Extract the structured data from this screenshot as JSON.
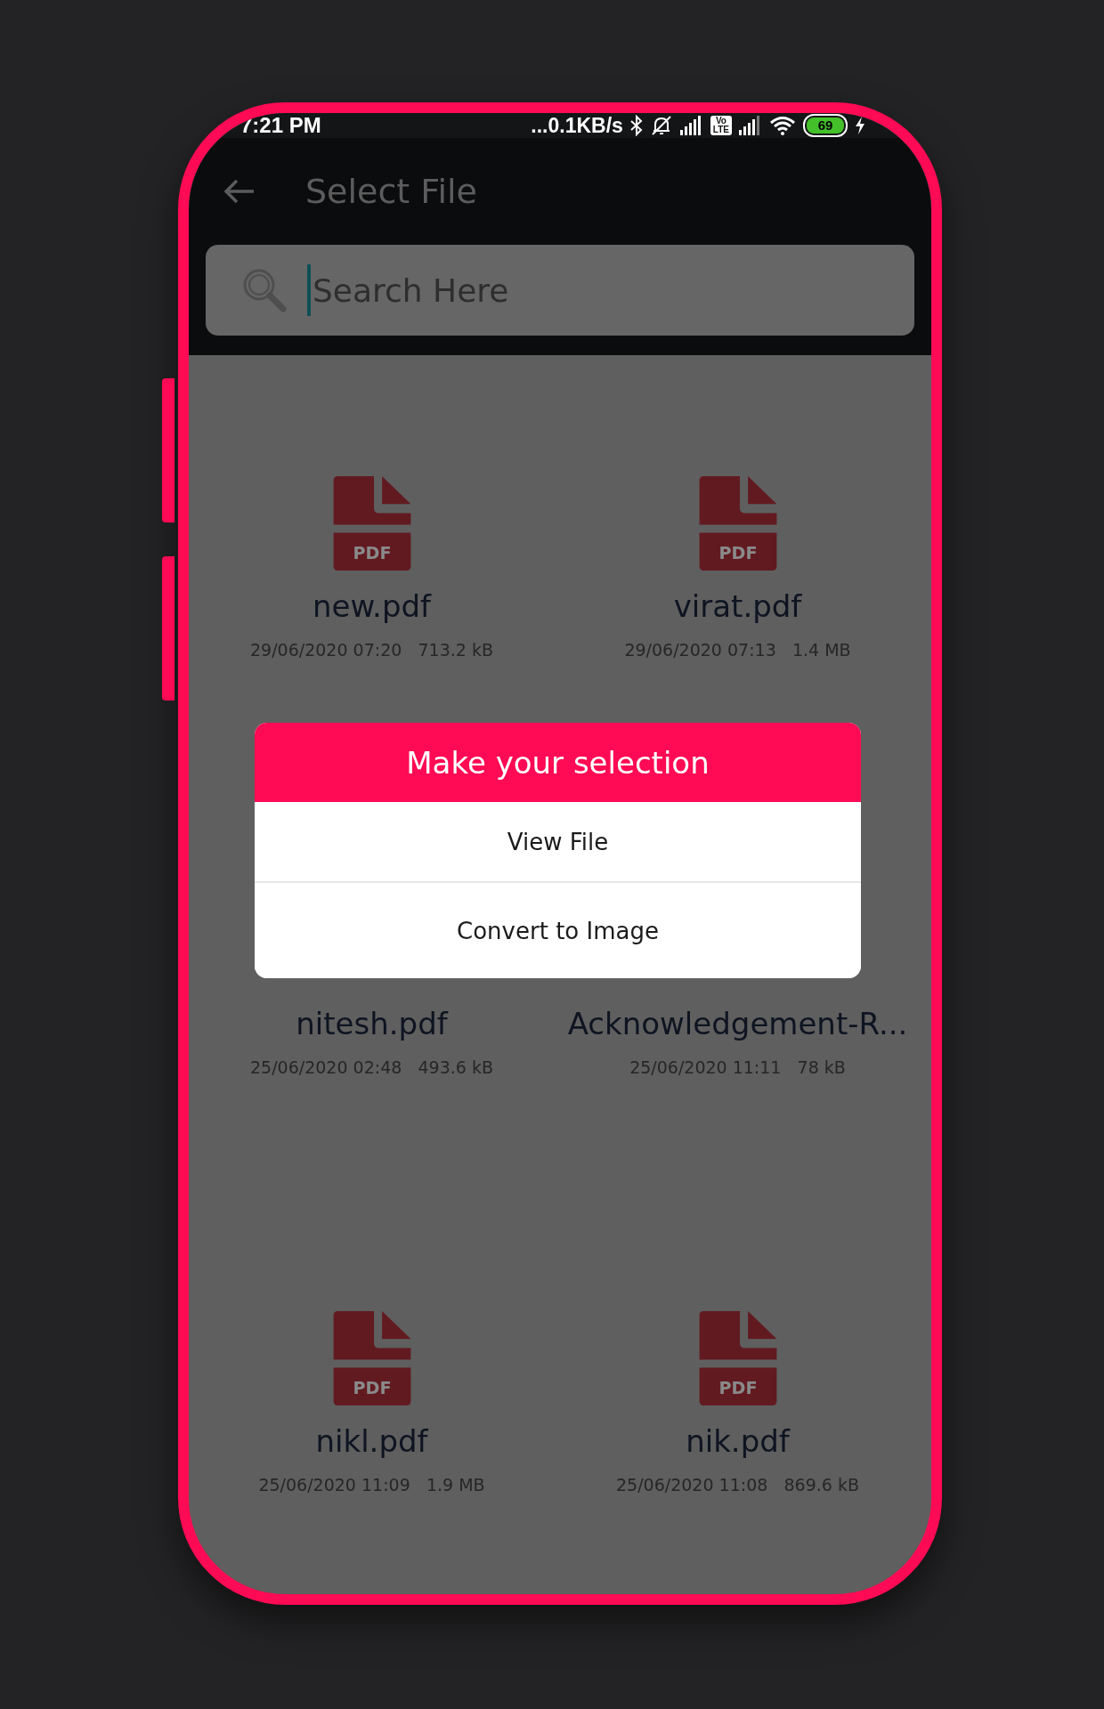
{
  "status_bar": {
    "time": "7:21 PM",
    "net_speed": "...0.1KB/s",
    "volte": [
      "Vo",
      "LTE"
    ],
    "battery": "69"
  },
  "app_bar": {
    "title": "Select File"
  },
  "search": {
    "placeholder": "Search Here"
  },
  "files": [
    {
      "name": "new.pdf",
      "date": "29/06/2020 07:20",
      "size": "713.2 kB",
      "icon_text": "PDF"
    },
    {
      "name": "virat.pdf",
      "date": "29/06/2020 07:13",
      "size": "1.4 MB",
      "icon_text": "PDF"
    },
    {
      "name": "nitesh.pdf",
      "date": "25/06/2020 02:48",
      "size": "493.6 kB"
    },
    {
      "name": "Acknowledgement-R...",
      "date": "25/06/2020 11:11",
      "size": "78 kB"
    },
    {
      "name": "nikl.pdf",
      "date": "25/06/2020 11:09",
      "size": "1.9 MB",
      "icon_text": "PDF"
    },
    {
      "name": "nik.pdf",
      "date": "25/06/2020 11:08",
      "size": "869.6 kB",
      "icon_text": "PDF"
    }
  ],
  "dialog": {
    "title": "Make your selection",
    "options": [
      "View File",
      "Convert to Image"
    ]
  }
}
